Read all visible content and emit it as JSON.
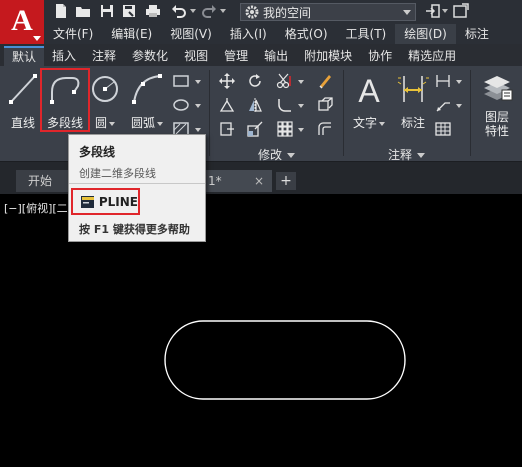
{
  "titlebar": {
    "app_logo_letter": "A",
    "workspace": "我的空间",
    "icons": [
      "new-icon",
      "open-icon",
      "save-icon",
      "save-as-icon",
      "print-icon",
      "undo-icon",
      "redo-icon",
      "gear-icon",
      "sign-in-icon",
      "exchange-icon"
    ]
  },
  "menubar": {
    "items": [
      "文件(F)",
      "编辑(E)",
      "视图(V)",
      "插入(I)",
      "格式(O)",
      "工具(T)",
      "绘图(D)",
      "标注"
    ]
  },
  "ribbon_tabs": [
    "默认",
    "插入",
    "注释",
    "参数化",
    "视图",
    "管理",
    "输出",
    "附加模块",
    "协作",
    "精选应用"
  ],
  "ribbon": {
    "draw_buttons": {
      "line": "直线",
      "polyline": "多段线",
      "circle": "圆",
      "arc": "圆弧"
    },
    "modify_title": "修改",
    "annotation": {
      "text": "文字",
      "dimension": "标注",
      "title": "注释"
    },
    "layers": {
      "label_line1": "图层",
      "label_line2": "特性"
    }
  },
  "tooltip": {
    "title": "多段线",
    "description": "创建二维多段线",
    "command": "PLINE",
    "help": "按 F1 键获得更多帮助"
  },
  "filetabs": {
    "start": "开始",
    "drawing_suffix": "1*",
    "close": "×",
    "new": "+"
  },
  "canvas": {
    "viewport_label": "[−][俯视][二",
    "background": "#000000",
    "stroke": "#ffffff"
  },
  "colors": {
    "accent_red": "#e0262b",
    "logo_red": "#c5191e",
    "ribbon_bg": "#3b4049",
    "title_bg": "#2b2f36"
  }
}
